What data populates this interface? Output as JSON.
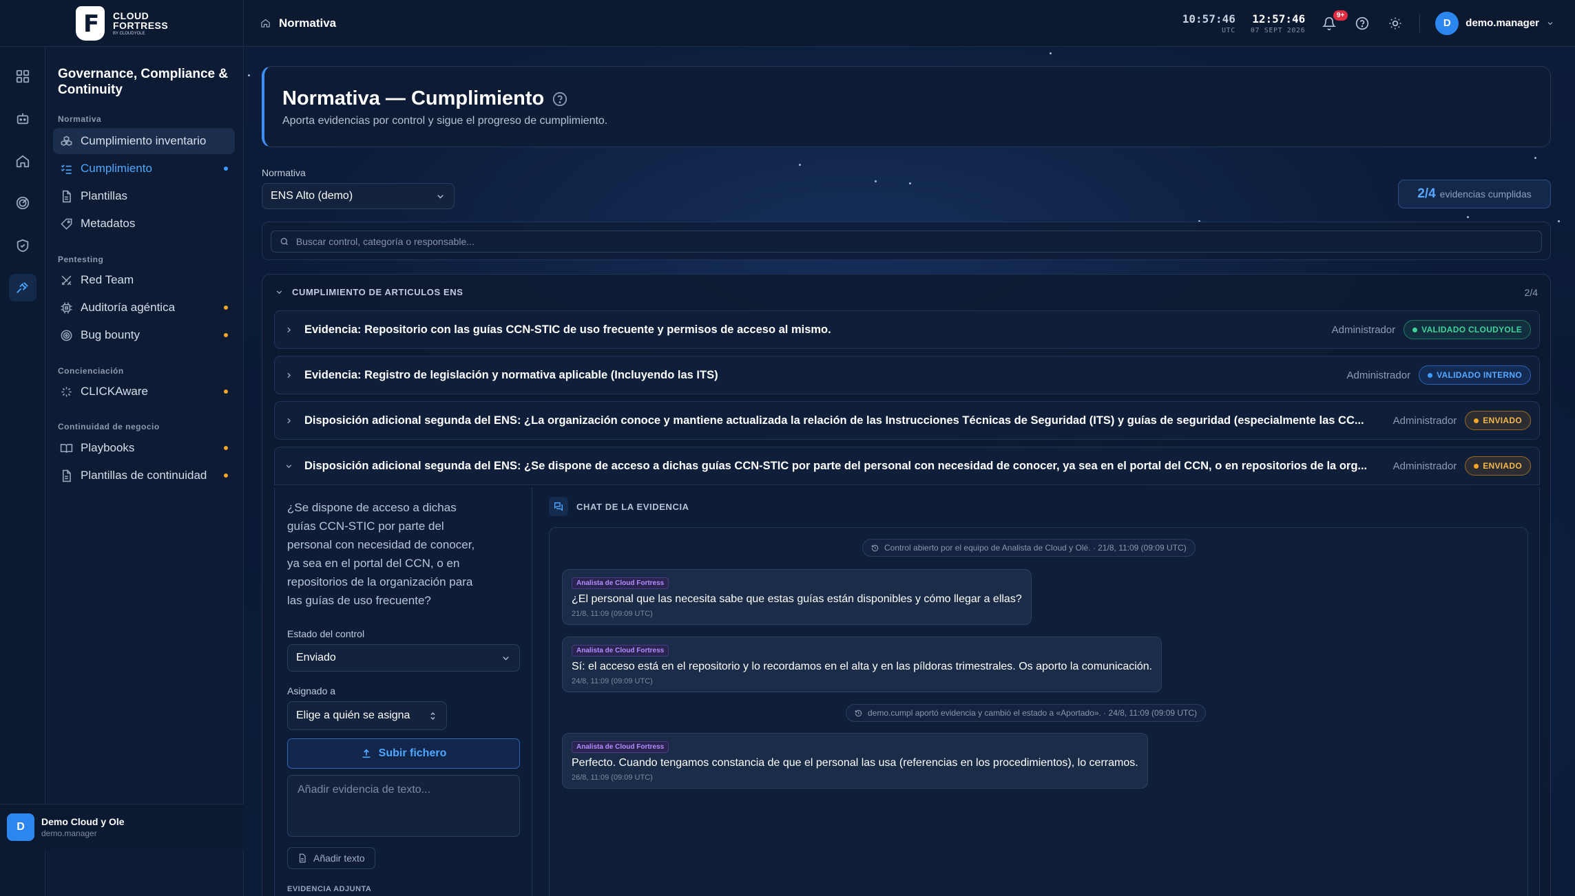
{
  "brand": {
    "line1": "CLOUD",
    "line2": "FORTRESS",
    "line3": "BY CLOUDYOLE"
  },
  "breadcrumb": "Normativa",
  "clocks": [
    {
      "time": "10:57:46",
      "label": "UTC"
    },
    {
      "time": "12:57:46",
      "label": "07 SEPT 2026"
    }
  ],
  "notifications": {
    "badge": "9+"
  },
  "user": {
    "initial": "D",
    "name": "demo.manager"
  },
  "sidebar": {
    "title": "Governance, Compliance & Continuity",
    "sections": [
      {
        "label": "Normativa",
        "items": [
          {
            "label": "Cumplimiento inventario"
          },
          {
            "label": "Cumplimiento"
          },
          {
            "label": "Plantillas"
          },
          {
            "label": "Metadatos"
          }
        ]
      },
      {
        "label": "Pentesting",
        "items": [
          {
            "label": "Red Team"
          },
          {
            "label": "Auditoría agéntica"
          },
          {
            "label": "Bug bounty"
          }
        ]
      },
      {
        "label": "Concienciación",
        "items": [
          {
            "label": "CLICKAware"
          }
        ]
      },
      {
        "label": "Continuidad de negocio",
        "items": [
          {
            "label": "Playbooks"
          },
          {
            "label": "Plantillas de continuidad"
          }
        ]
      }
    ],
    "footer": {
      "initial": "D",
      "name": "Demo Cloud y Ole",
      "sub": "demo.manager"
    }
  },
  "page": {
    "title": "Normativa — Cumplimiento",
    "subtitle": "Aporta evidencias por control y sigue el progreso de cumplimiento.",
    "normativa_label": "Normativa",
    "normativa_value": "ENS Alto (demo)",
    "summary_value": "2/4",
    "summary_text": "evidencias cumplidas",
    "search_placeholder": "Buscar control, categoría o responsable..."
  },
  "panel": {
    "title": "CUMPLIMIENTO DE ARTICULOS ENS",
    "count": "2/4",
    "rows": [
      {
        "title": "Evidencia: Repositorio con las guías CCN-STIC de uso frecuente y permisos de acceso al mismo.",
        "owner": "Administrador",
        "status": "VALIDADO CLOUDYOLE"
      },
      {
        "title": "Evidencia: Registro de legislación y normativa aplicable (Incluyendo las ITS)",
        "owner": "Administrador",
        "status": "VALIDADO INTERNO"
      },
      {
        "title": "Disposición adicional segunda del ENS: ¿La organización conoce y mantiene actualizada la relación de las Instrucciones Técnicas de Seguridad (ITS) y guías de seguridad (especialmente las CC...",
        "owner": "Administrador",
        "status": "ENVIADO"
      },
      {
        "title": "Disposición adicional segunda del ENS: ¿Se dispone de acceso a dichas guías CCN-STIC por parte del personal con necesidad de conocer, ya sea en el portal del CCN, o en repositorios de la org...",
        "owner": "Administrador",
        "status": "ENVIADO"
      }
    ]
  },
  "detail": {
    "question": "¿Se dispone de acceso a dichas guías CCN-STIC por parte del personal con necesidad de conocer, ya sea en el portal del CCN, o en repositorios de la organización para las guías de uso frecuente?",
    "estado_label": "Estado del control",
    "estado_value": "Enviado",
    "asignado_label": "Asignado a",
    "asignado_value": "Elige a quién se asigna",
    "upload_label": "Subir fichero",
    "evidence_placeholder": "Añadir evidencia de texto...",
    "add_text_label": "Añadir texto",
    "attached_label": "EVIDENCIA ADJUNTA"
  },
  "chat": {
    "title": "CHAT DE LA EVIDENCIA",
    "system1": "Control abierto por el equipo de Analista de Cloud y Olé. · 21/8, 11:09 (09:09 UTC)",
    "system2": "demo.cumpl aportó evidencia y cambió el estado a «Aportado». · 24/8, 11:09 (09:09 UTC)",
    "messages": [
      {
        "tag": "Analista de Cloud Fortress",
        "text": "¿El personal que las necesita sabe que estas guías están disponibles y cómo llegar a ellas?",
        "time": "21/8, 11:09 (09:09 UTC)"
      },
      {
        "tag": "Analista de Cloud Fortress",
        "text": "Sí: el acceso está en el repositorio y lo recordamos en el alta y en las píldoras trimestrales. Os aporto la comunicación.",
        "time": "24/8, 11:09 (09:09 UTC)"
      },
      {
        "tag": "Analista de Cloud Fortress",
        "text": "Perfecto. Cuando tengamos constancia de que el personal las usa (referencias en los procedimientos), lo cerramos.",
        "time": "26/8, 11:09 (09:09 UTC)"
      }
    ]
  },
  "colors": {
    "accent": "#3d9cff",
    "green": "#3fd39a",
    "orange": "#f5a623",
    "badge": "#e02d42"
  }
}
